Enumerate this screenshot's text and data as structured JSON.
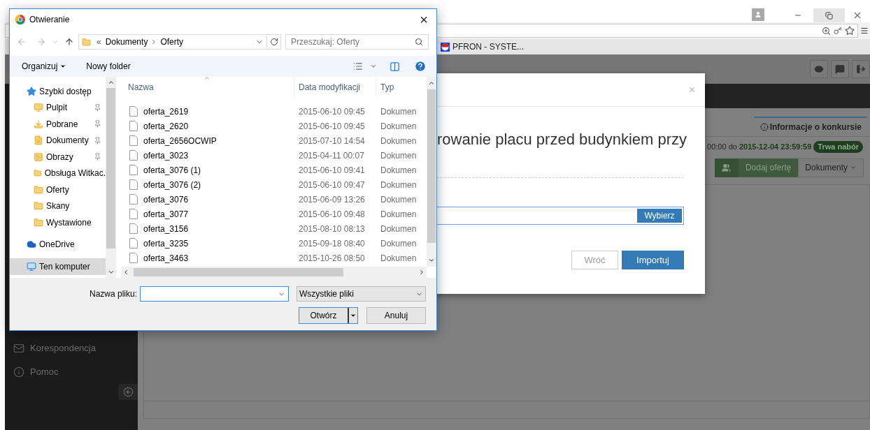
{
  "browser": {
    "bookmark": "PFRON - SYSTE..."
  },
  "page": {
    "sidebar_items": [
      {
        "kind": "mail",
        "label": "Korespondencja"
      },
      {
        "kind": "info",
        "label": "Pomoc"
      }
    ],
    "tab": {
      "label": "Informacje o konkursie",
      "selected": true
    },
    "date_prefix": "00:00 do",
    "date_end": "2015-12-04 23:59:59",
    "status_badge": "Trwa nabór",
    "add_offer_button": "Dodaj ofertę",
    "documents_button": "Dokumenty"
  },
  "modal": {
    "close": "×",
    "title": "rowanie placu przed budynkiem przy",
    "choose_button": "Wybierz",
    "back_button": "Wróć",
    "import_button": "Importuj"
  },
  "dialog": {
    "title": "Otwieranie",
    "close": "×",
    "path_overflow": "«",
    "path": [
      "Dokumenty",
      "Oferty"
    ],
    "search_placeholder": "Przeszukaj: Oferty",
    "toolbar": {
      "organize": "Organizuj",
      "new_folder": "Nowy folder"
    },
    "nav": [
      {
        "kind": "star",
        "label": "Szybki dostęp",
        "selected": false,
        "children": [
          {
            "kind": "desktop",
            "label": "Pulpit",
            "pinned": true,
            "selected": false
          },
          {
            "kind": "download",
            "label": "Pobrane",
            "pinned": true,
            "selected": false
          },
          {
            "kind": "documents",
            "label": "Dokumenty",
            "pinned": true,
            "selected": false
          },
          {
            "kind": "pictures",
            "label": "Obrazy",
            "pinned": true,
            "selected": false
          },
          {
            "kind": "folder",
            "label": "Obsługa Witkac.",
            "pinned": false,
            "selected": false
          },
          {
            "kind": "folder",
            "label": "Oferty",
            "pinned": false,
            "selected": false
          },
          {
            "kind": "folder",
            "label": "Skany",
            "pinned": false,
            "selected": false
          },
          {
            "kind": "folder",
            "label": "Wystawione",
            "pinned": false,
            "selected": false
          }
        ]
      },
      {
        "kind": "cloud",
        "label": "OneDrive",
        "selected": false
      },
      {
        "kind": "computer",
        "label": "Ten komputer",
        "selected": true
      }
    ],
    "columns": [
      "Nazwa",
      "Data modyfikacji",
      "Typ"
    ],
    "files": [
      {
        "name": "oferta_2619",
        "date": "2015-06-10 09:45",
        "type": "Dokumen"
      },
      {
        "name": "oferta_2620",
        "date": "2015-06-10 09:45",
        "type": "Dokumen"
      },
      {
        "name": "oferta_2656OCWIP",
        "date": "2015-07-10 14:54",
        "type": "Dokumen"
      },
      {
        "name": "oferta_3023",
        "date": "2015-04-11 00:07",
        "type": "Dokumen"
      },
      {
        "name": "oferta_3076 (1)",
        "date": "2015-06-10 09:41",
        "type": "Dokumen"
      },
      {
        "name": "oferta_3076 (2)",
        "date": "2015-06-10 09:47",
        "type": "Dokumen"
      },
      {
        "name": "oferta_3076",
        "date": "2015-06-09 13:26",
        "type": "Dokumen"
      },
      {
        "name": "oferta_3077",
        "date": "2015-06-10 09:48",
        "type": "Dokumen"
      },
      {
        "name": "oferta_3156",
        "date": "2015-08-10 08:13",
        "type": "Dokumen"
      },
      {
        "name": "oferta_3235",
        "date": "2015-09-18 08:40",
        "type": "Dokumen"
      },
      {
        "name": "oferta_3463",
        "date": "2015-10-26 08:50",
        "type": "Dokumen"
      }
    ],
    "file_name_label": "Nazwa pliku:",
    "filter": "Wszystkie pliki",
    "open_button": "Otwórz",
    "cancel_button": "Anuluj"
  }
}
